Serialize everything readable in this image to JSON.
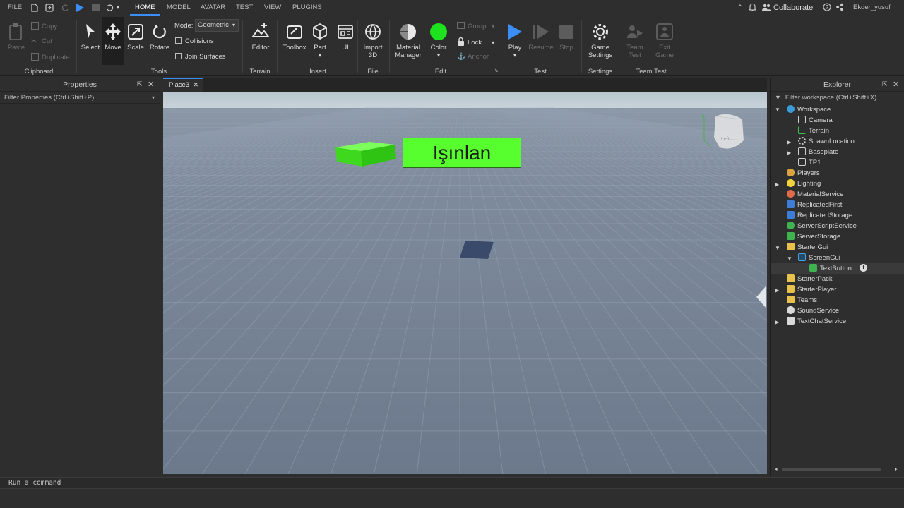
{
  "menubar": {
    "file": "FILE",
    "tabs": [
      "HOME",
      "MODEL",
      "AVATAR",
      "TEST",
      "VIEW",
      "PLUGINS"
    ],
    "collaborate": "Collaborate",
    "username": "Ekder_yusuf"
  },
  "ribbon": {
    "clipboard": {
      "paste": "Paste",
      "copy": "Copy",
      "cut": "Cut",
      "duplicate": "Duplicate",
      "group_label": "Clipboard"
    },
    "tools": {
      "select": "Select",
      "move": "Move",
      "scale": "Scale",
      "rotate": "Rotate",
      "mode_label": "Mode:",
      "mode_value": "Geometric",
      "collisions": "Collisions",
      "join_surfaces": "Join Surfaces",
      "group_label": "Tools"
    },
    "terrain": {
      "editor": "Editor",
      "group_label": "Terrain"
    },
    "insert": {
      "toolbox": "Toolbox",
      "part": "Part",
      "ui": "UI",
      "group_label": "Insert"
    },
    "file": {
      "import3d_line1": "Import",
      "import3d_line2": "3D",
      "group_label": "File"
    },
    "edit": {
      "material_line1": "Material",
      "material_line2": "Manager",
      "color": "Color",
      "group": "Group",
      "lock": "Lock",
      "anchor": "Anchor",
      "group_label": "Edit"
    },
    "test": {
      "play": "Play",
      "resume": "Resume",
      "stop": "Stop",
      "group_label": "Test"
    },
    "settings": {
      "game_line1": "Game",
      "game_line2": "Settings",
      "group_label": "Settings"
    },
    "team_test": {
      "team_line1": "Team",
      "team_line2": "Test",
      "exit_line1": "Exit",
      "exit_line2": "Game",
      "group_label": "Team Test"
    },
    "colors": {
      "color_swatch": "#1ee21e",
      "play_blue": "#3a8ef6"
    }
  },
  "properties": {
    "title": "Properties",
    "filter_placeholder": "Filter Properties (Ctrl+Shift+P)"
  },
  "document_tab": {
    "label": "Place3"
  },
  "viewport": {
    "button_text": "Işınlan",
    "button_color": "#57ff2e",
    "part_color": "#47f52a"
  },
  "explorer": {
    "title": "Explorer",
    "filter_placeholder": "Filter workspace (Ctrl+Shift+X)",
    "items": [
      {
        "label": "Workspace",
        "icon": "globe-icon"
      },
      {
        "label": "Camera",
        "icon": "camera-icon"
      },
      {
        "label": "Terrain",
        "icon": "terrain-icon"
      },
      {
        "label": "SpawnLocation",
        "icon": "spawn-icon"
      },
      {
        "label": "Baseplate",
        "icon": "part-icon"
      },
      {
        "label": "TP1",
        "icon": "part-icon"
      },
      {
        "label": "Players",
        "icon": "players-icon"
      },
      {
        "label": "Lighting",
        "icon": "bulb-icon"
      },
      {
        "label": "MaterialService",
        "icon": "material-icon"
      },
      {
        "label": "ReplicatedFirst",
        "icon": "replicated-icon"
      },
      {
        "label": "ReplicatedStorage",
        "icon": "replicated-icon"
      },
      {
        "label": "ServerScriptService",
        "icon": "script-service-icon"
      },
      {
        "label": "ServerStorage",
        "icon": "storage-icon"
      },
      {
        "label": "StarterGui",
        "icon": "folder-icon"
      },
      {
        "label": "ScreenGui",
        "icon": "screengui-icon"
      },
      {
        "label": "TextButton",
        "icon": "textbutton-icon"
      },
      {
        "label": "StarterPack",
        "icon": "folder-icon"
      },
      {
        "label": "StarterPlayer",
        "icon": "folder-icon"
      },
      {
        "label": "Teams",
        "icon": "folder-icon"
      },
      {
        "label": "SoundService",
        "icon": "sound-icon"
      },
      {
        "label": "TextChatService",
        "icon": "chat-icon"
      }
    ]
  },
  "command_bar": {
    "placeholder": "Run a command"
  }
}
